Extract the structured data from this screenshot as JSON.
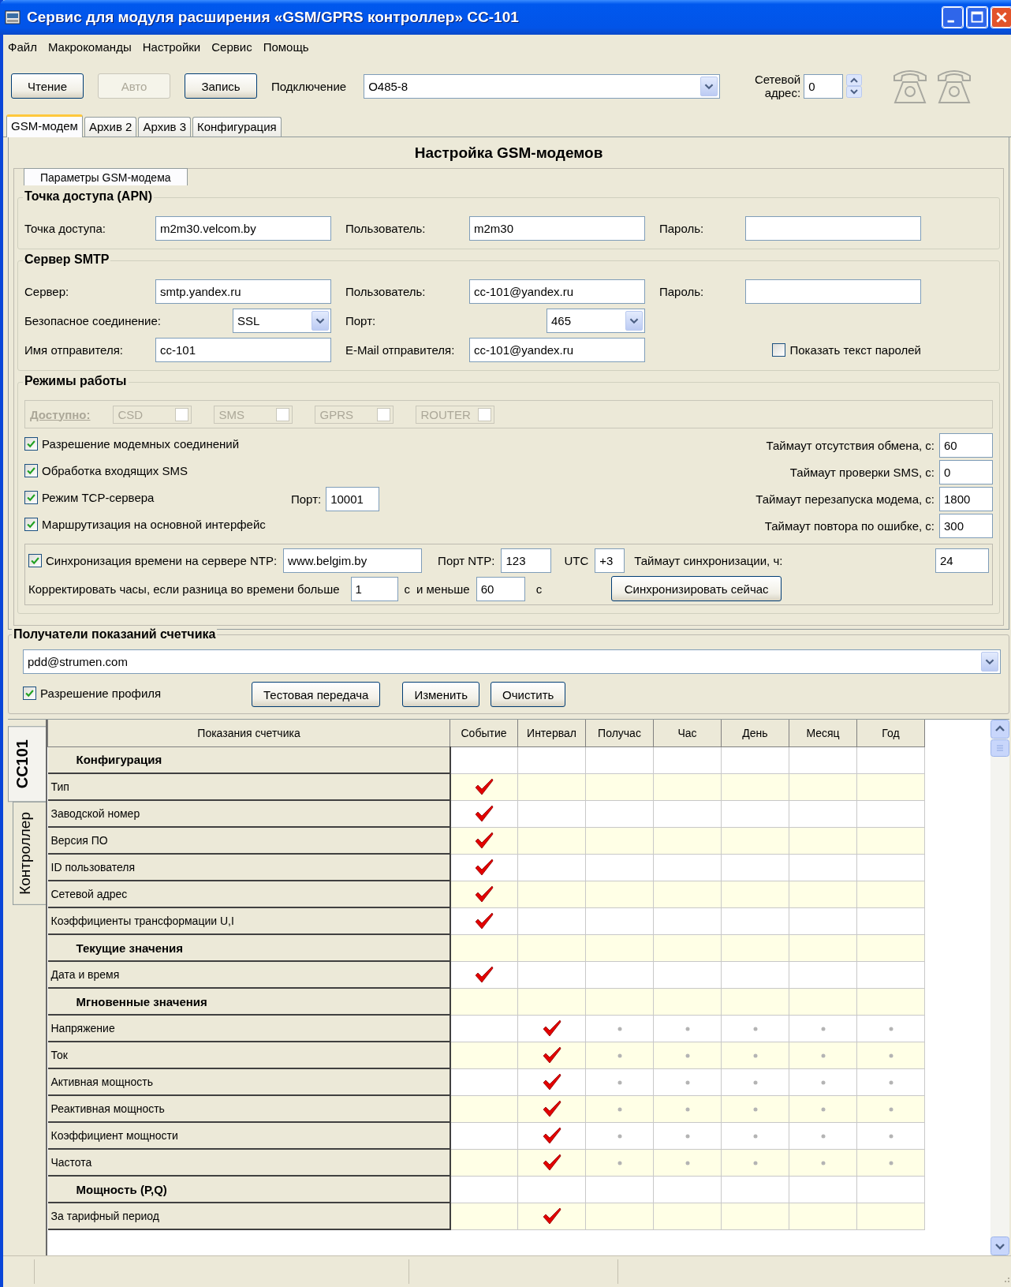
{
  "window": {
    "title": "Сервис для модуля расширения «GSM/GPRS контроллер» CC-101"
  },
  "menu": [
    "Файл",
    "Макрокоманды",
    "Настройки",
    "Сервис",
    "Помощь"
  ],
  "toolbar": {
    "buttons": [
      {
        "label": "Чтение",
        "disabled": false
      },
      {
        "label": "Авто",
        "disabled": true
      },
      {
        "label": "Запись",
        "disabled": false
      }
    ],
    "connection_label": "Подключение",
    "connection": "O485-8",
    "address_label": "Сетевой адрес:",
    "address": "0"
  },
  "tabs": [
    {
      "label": "GSM-модем",
      "selected": true
    },
    {
      "label": "Архив 2",
      "selected": false
    },
    {
      "label": "Архив 3",
      "selected": false
    },
    {
      "label": "Конфигурация",
      "selected": false
    }
  ],
  "heading": "Настройка GSM-модемов",
  "subtab": "Параметры GSM-модема",
  "apn": {
    "title": "Точка доступа (APN)",
    "items": [
      {
        "kind": "field",
        "label": "Точка доступа:",
        "value": "m2m30.velcom.by"
      },
      {
        "kind": "field",
        "label": "Пользователь:",
        "value": "m2m30"
      },
      {
        "kind": "field",
        "label": "Пароль:"
      }
    ]
  },
  "smtp": {
    "title": "Сервер SMTP",
    "items": [
      {
        "kind": "field",
        "label": "Сервер:",
        "value": "smtp.yandex.ru"
      },
      {
        "kind": "field",
        "label": "Пользователь:",
        "value": "cc-101@yandex.ru"
      },
      {
        "kind": "field",
        "label": "Пароль:"
      },
      {
        "kind": "combo",
        "label": "Безопасное соединение:",
        "value": "SSL"
      },
      {
        "kind": "combo",
        "label": "Порт:",
        "value": "465"
      },
      {
        "kind": "empty"
      },
      {
        "kind": "field",
        "label": "Имя отправителя:",
        "value": "cc-101"
      },
      {
        "kind": "field",
        "label": "E-Mail отправителя:",
        "value": "cc-101@yandex.ru"
      },
      {
        "kind": "checkbox",
        "label": "Показать текст паролей",
        "checked": false
      }
    ]
  },
  "modes": {
    "title": "Режимы работы",
    "available_label": "Доступно:",
    "available": [
      {
        "label": "CSD",
        "checked": false
      },
      {
        "label": "SMS",
        "checked": false
      },
      {
        "label": "GPRS",
        "checked": false
      },
      {
        "label": "ROUTER",
        "checked": false
      }
    ],
    "options": [
      {
        "label": "Разрешение модемных соединений",
        "checked": true
      },
      {
        "label": "Обработка входящих SMS",
        "checked": true
      },
      {
        "label": "Режим TCP-сервера",
        "checked": true,
        "port_label": "Порт:",
        "port": "10001"
      },
      {
        "label": "Маршрутизация на основной интерфейс",
        "checked": true
      }
    ],
    "timeouts": [
      {
        "label": "Таймаут отсутствия обмена, с:",
        "value": "60"
      },
      {
        "label": "Таймаут проверки SMS, с:",
        "value": "0"
      },
      {
        "label": "Таймаут перезапуска модема, с:",
        "value": "1800"
      },
      {
        "label": "Таймаут повтора по ошибке, с:",
        "value": "300"
      }
    ]
  },
  "ntp": {
    "label": "Синхронизация времени на сервере NTP:",
    "checked": true,
    "server": "www.belgim.by",
    "port_label": "Порт NTP:",
    "port": "123",
    "utc_label": "UTC",
    "utc": "+3",
    "timeout_label": "Таймаут синхронизации, ч:",
    "timeout": "24",
    "correct_label": "Корректировать часы, если разница во времени больше",
    "min": "1",
    "unit_min": "с",
    "less_label": "и меньше",
    "max": "60",
    "unit_max": "с",
    "sync_button": "Синхронизировать сейчас"
  },
  "recipients": {
    "title": "Получатели показаний счетчика",
    "selected": "pdd@strumen.com",
    "profile": {
      "label": "Разрешение профиля",
      "checked": true
    },
    "buttons": [
      "Тестовая передача",
      "Изменить",
      "Очистить"
    ]
  },
  "side_tabs": [
    {
      "label": "CC101",
      "selected": true
    },
    {
      "label": "Контроллер",
      "selected": false
    }
  ],
  "table": {
    "columns": [
      "Показания счетчика",
      "Событие",
      "Интервал",
      "Получас",
      "Час",
      "День",
      "Месяц",
      "Год"
    ],
    "rows": [
      {
        "kind": "group",
        "label": "Конфигурация"
      },
      {
        "kind": "item",
        "label": "Тип",
        "cells": [
          {
            "checked": true,
            "dot": false
          },
          {
            "checked": false,
            "dot": false
          },
          {
            "checked": false,
            "dot": false
          },
          {
            "checked": false,
            "dot": false
          },
          {
            "checked": false,
            "dot": false
          },
          {
            "checked": false,
            "dot": false
          },
          {
            "checked": false,
            "dot": false
          }
        ]
      },
      {
        "kind": "item",
        "label": "Заводской номер",
        "cells": [
          {
            "checked": true,
            "dot": false
          },
          {
            "checked": false,
            "dot": false
          },
          {
            "checked": false,
            "dot": false
          },
          {
            "checked": false,
            "dot": false
          },
          {
            "checked": false,
            "dot": false
          },
          {
            "checked": false,
            "dot": false
          },
          {
            "checked": false,
            "dot": false
          }
        ]
      },
      {
        "kind": "item",
        "label": "Версия ПО",
        "cells": [
          {
            "checked": true,
            "dot": false
          },
          {
            "checked": false,
            "dot": false
          },
          {
            "checked": false,
            "dot": false
          },
          {
            "checked": false,
            "dot": false
          },
          {
            "checked": false,
            "dot": false
          },
          {
            "checked": false,
            "dot": false
          },
          {
            "checked": false,
            "dot": false
          }
        ]
      },
      {
        "kind": "item",
        "label": "ID пользователя",
        "cells": [
          {
            "checked": true,
            "dot": false
          },
          {
            "checked": false,
            "dot": false
          },
          {
            "checked": false,
            "dot": false
          },
          {
            "checked": false,
            "dot": false
          },
          {
            "checked": false,
            "dot": false
          },
          {
            "checked": false,
            "dot": false
          },
          {
            "checked": false,
            "dot": false
          }
        ]
      },
      {
        "kind": "item",
        "label": "Сетевой адрес",
        "cells": [
          {
            "checked": true,
            "dot": false
          },
          {
            "checked": false,
            "dot": false
          },
          {
            "checked": false,
            "dot": false
          },
          {
            "checked": false,
            "dot": false
          },
          {
            "checked": false,
            "dot": false
          },
          {
            "checked": false,
            "dot": false
          },
          {
            "checked": false,
            "dot": false
          }
        ]
      },
      {
        "kind": "item",
        "label": "Коэффициенты трансформации U,I",
        "cells": [
          {
            "checked": true,
            "dot": false
          },
          {
            "checked": false,
            "dot": false
          },
          {
            "checked": false,
            "dot": false
          },
          {
            "checked": false,
            "dot": false
          },
          {
            "checked": false,
            "dot": false
          },
          {
            "checked": false,
            "dot": false
          },
          {
            "checked": false,
            "dot": false
          }
        ]
      },
      {
        "kind": "group",
        "label": "Текущие значения"
      },
      {
        "kind": "item",
        "label": "Дата и время",
        "cells": [
          {
            "checked": true,
            "dot": false
          },
          {
            "checked": false,
            "dot": false
          },
          {
            "checked": false,
            "dot": false
          },
          {
            "checked": false,
            "dot": false
          },
          {
            "checked": false,
            "dot": false
          },
          {
            "checked": false,
            "dot": false
          },
          {
            "checked": false,
            "dot": false
          }
        ]
      },
      {
        "kind": "group",
        "label": "Мгновенные значения"
      },
      {
        "kind": "item",
        "label": "Напряжение",
        "cells": [
          {
            "checked": false,
            "dot": false
          },
          {
            "checked": true,
            "dot": false
          },
          {
            "checked": false,
            "dot": true
          },
          {
            "checked": false,
            "dot": true
          },
          {
            "checked": false,
            "dot": true
          },
          {
            "checked": false,
            "dot": true
          },
          {
            "checked": false,
            "dot": true
          }
        ]
      },
      {
        "kind": "item",
        "label": "Ток",
        "cells": [
          {
            "checked": false,
            "dot": false
          },
          {
            "checked": true,
            "dot": false
          },
          {
            "checked": false,
            "dot": true
          },
          {
            "checked": false,
            "dot": true
          },
          {
            "checked": false,
            "dot": true
          },
          {
            "checked": false,
            "dot": true
          },
          {
            "checked": false,
            "dot": true
          }
        ]
      },
      {
        "kind": "item",
        "label": "Активная мощность",
        "cells": [
          {
            "checked": false,
            "dot": false
          },
          {
            "checked": true,
            "dot": false
          },
          {
            "checked": false,
            "dot": true
          },
          {
            "checked": false,
            "dot": true
          },
          {
            "checked": false,
            "dot": true
          },
          {
            "checked": false,
            "dot": true
          },
          {
            "checked": false,
            "dot": true
          }
        ]
      },
      {
        "kind": "item",
        "label": "Реактивная мощность",
        "cells": [
          {
            "checked": false,
            "dot": false
          },
          {
            "checked": true,
            "dot": false
          },
          {
            "checked": false,
            "dot": true
          },
          {
            "checked": false,
            "dot": true
          },
          {
            "checked": false,
            "dot": true
          },
          {
            "checked": false,
            "dot": true
          },
          {
            "checked": false,
            "dot": true
          }
        ]
      },
      {
        "kind": "item",
        "label": "Коэффициент мощности",
        "cells": [
          {
            "checked": false,
            "dot": false
          },
          {
            "checked": true,
            "dot": false
          },
          {
            "checked": false,
            "dot": true
          },
          {
            "checked": false,
            "dot": true
          },
          {
            "checked": false,
            "dot": true
          },
          {
            "checked": false,
            "dot": true
          },
          {
            "checked": false,
            "dot": true
          }
        ]
      },
      {
        "kind": "item",
        "label": "Частота",
        "cells": [
          {
            "checked": false,
            "dot": false
          },
          {
            "checked": true,
            "dot": false
          },
          {
            "checked": false,
            "dot": true
          },
          {
            "checked": false,
            "dot": true
          },
          {
            "checked": false,
            "dot": true
          },
          {
            "checked": false,
            "dot": true
          },
          {
            "checked": false,
            "dot": true
          }
        ]
      },
      {
        "kind": "group",
        "label": "Мощность (P,Q)"
      },
      {
        "kind": "item",
        "label": "За тарифный период",
        "cells": [
          {
            "checked": false,
            "dot": false
          },
          {
            "checked": true,
            "dot": false
          },
          {
            "checked": false,
            "dot": false
          },
          {
            "checked": false,
            "dot": false
          },
          {
            "checked": false,
            "dot": false
          },
          {
            "checked": false,
            "dot": false
          },
          {
            "checked": false,
            "dot": false
          }
        ]
      }
    ]
  }
}
